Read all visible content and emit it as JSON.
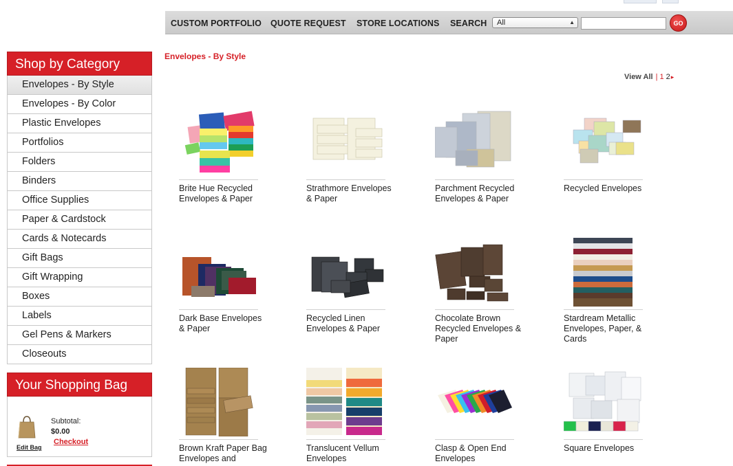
{
  "nav": {
    "links": [
      "CUSTOM PORTFOLIO",
      "QUOTE REQUEST",
      "STORE LOCATIONS",
      "SEARCH"
    ],
    "search_select": "All",
    "search_value": "",
    "go_label": "GO"
  },
  "sidebar": {
    "title": "Shop by Category",
    "items": [
      {
        "label": "Envelopes - By Style",
        "active": true
      },
      {
        "label": "Envelopes - By Color"
      },
      {
        "label": "Plastic Envelopes"
      },
      {
        "label": "Portfolios"
      },
      {
        "label": "Folders"
      },
      {
        "label": "Binders"
      },
      {
        "label": "Office Supplies"
      },
      {
        "label": "Paper & Cardstock"
      },
      {
        "label": "Cards & Notecards"
      },
      {
        "label": "Gift Bags"
      },
      {
        "label": "Gift Wrapping"
      },
      {
        "label": "Boxes"
      },
      {
        "label": "Labels"
      },
      {
        "label": "Gel Pens & Markers"
      },
      {
        "label": "Closeouts"
      }
    ]
  },
  "bag": {
    "title": "Your Shopping Bag",
    "subtotal_label": "Subtotal:",
    "subtotal_value": "$0.00",
    "checkout": "Checkout",
    "edit_bag": "Edit Bag"
  },
  "main": {
    "page_title": "Envelopes - By Style",
    "pager": {
      "view_all": "View All",
      "sep": "|",
      "page1": "1",
      "page2": "2",
      "arrow": "▸"
    },
    "products": [
      {
        "name": "Brite Hue Recycled Envelopes & Paper",
        "thumb": "brite"
      },
      {
        "name": "Strathmore Envelopes & Paper",
        "thumb": "strath"
      },
      {
        "name": "Parchment Recycled Envelopes & Paper",
        "thumb": "parch"
      },
      {
        "name": "Recycled Envelopes",
        "thumb": "recycled"
      },
      {
        "name": "Dark Base Envelopes & Paper",
        "thumb": "dark"
      },
      {
        "name": "Recycled Linen Envelopes & Paper",
        "thumb": "linen"
      },
      {
        "name": "Chocolate Brown Recycled Envelopes & Paper",
        "thumb": "choc"
      },
      {
        "name": "Stardream Metallic Envelopes, Paper, & Cards",
        "thumb": "stardream"
      },
      {
        "name": "Brown Kraft Paper Bag Envelopes and",
        "thumb": "kraft"
      },
      {
        "name": "Translucent Vellum Envelopes",
        "thumb": "vellum"
      },
      {
        "name": "Clasp & Open End Envelopes",
        "thumb": "clasp"
      },
      {
        "name": "Square Envelopes",
        "thumb": "square"
      }
    ]
  },
  "colors": {
    "brand_red": "#d62027",
    "nav_gray": "#d2d2d2"
  }
}
